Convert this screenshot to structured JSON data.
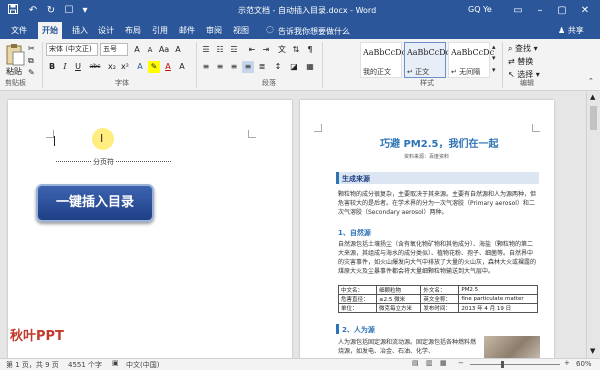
{
  "titlebar": {
    "title": "示范文档 - 自动插入目录.docx - Word",
    "user": "GQ Ye",
    "icons": [
      "save-icon",
      "undo-icon",
      "redo-icon",
      "touch-mode-icon",
      "customize-icon"
    ]
  },
  "tabs": [
    "文件",
    "开始",
    "插入",
    "设计",
    "布局",
    "引用",
    "邮件",
    "审阅",
    "视图"
  ],
  "active_tab": "开始",
  "tell_me": "告诉我你想要做什么",
  "share": "共享",
  "ribbon": {
    "clipboard": {
      "paste": "粘贴",
      "label": "剪贴板"
    },
    "font": {
      "name": "宋体 (中文正)",
      "size": "五号",
      "label": "字体",
      "buttons": [
        "B",
        "I",
        "U",
        "abc",
        "x₂",
        "x²"
      ]
    },
    "paragraph": {
      "label": "段落"
    },
    "styles": {
      "items": [
        {
          "preview": "AaBbCcDc",
          "name": "我的正文"
        },
        {
          "preview": "AaBbCcDc",
          "name": "↵ 正文"
        },
        {
          "preview": "AaBbCcDc",
          "name": "↵ 无间隔"
        }
      ],
      "label": "样式"
    },
    "editing": {
      "find": "查找",
      "replace": "替换",
      "select": "选择",
      "label": "编辑"
    }
  },
  "left_page": {
    "page_break": "分页符",
    "insert_button": "一键插入目录",
    "watermark": "秋叶PPT"
  },
  "right_page": {
    "title": "巧避 PM2.5，我们在一起",
    "source": "资料来源：百度资料",
    "section_heading": "生成来源",
    "intro": "颗粒物的成分很复杂，主要取决于其来源。主要有自然源和人为源两种，但危害较大的是后者。在学术界的分为一次气溶胶（Primary aerosol）和二次气溶胶（Secondary aerosol）两种。",
    "sub1": "1、自然源",
    "sub1_text": "自然源包括土壤扬尘（含有氧化物矿物和其他成分）、海盐（颗粒物的第二大来源，其组成与海水的成分类似）、植物花粉、孢子、细菌等。自然界中的灾害事件，如火山爆发向大气中排放了大量的火山灰，森林大火或裸露的煤原大火及尘暴事件都会将大量细颗粒物输送到大气层中。",
    "table": [
      [
        "中文名：",
        "细颗粒物",
        "外文名：",
        "PM2.5"
      ],
      [
        "危害直径：",
        "≤2.5 微米",
        "英文全称：",
        "fine particulate matter"
      ],
      [
        "单位：",
        "微克每立方米",
        "发布时间：",
        "2013 年 4 月 19 日"
      ]
    ],
    "sub2": "2、人为源",
    "sub2_text": "人为源包括固定源和流动源。固定源包括各种燃料燃烧源，如发电、冶金、石油、化学、"
  },
  "status": {
    "page": "第 1 页，共 9 页",
    "words": "4551 个字",
    "lang": "中文(中国)",
    "zoom": "60%"
  },
  "colors": {
    "word_blue": "#2b579a",
    "heading_blue": "#2e74b5",
    "button_navy": "#1f3f86"
  }
}
